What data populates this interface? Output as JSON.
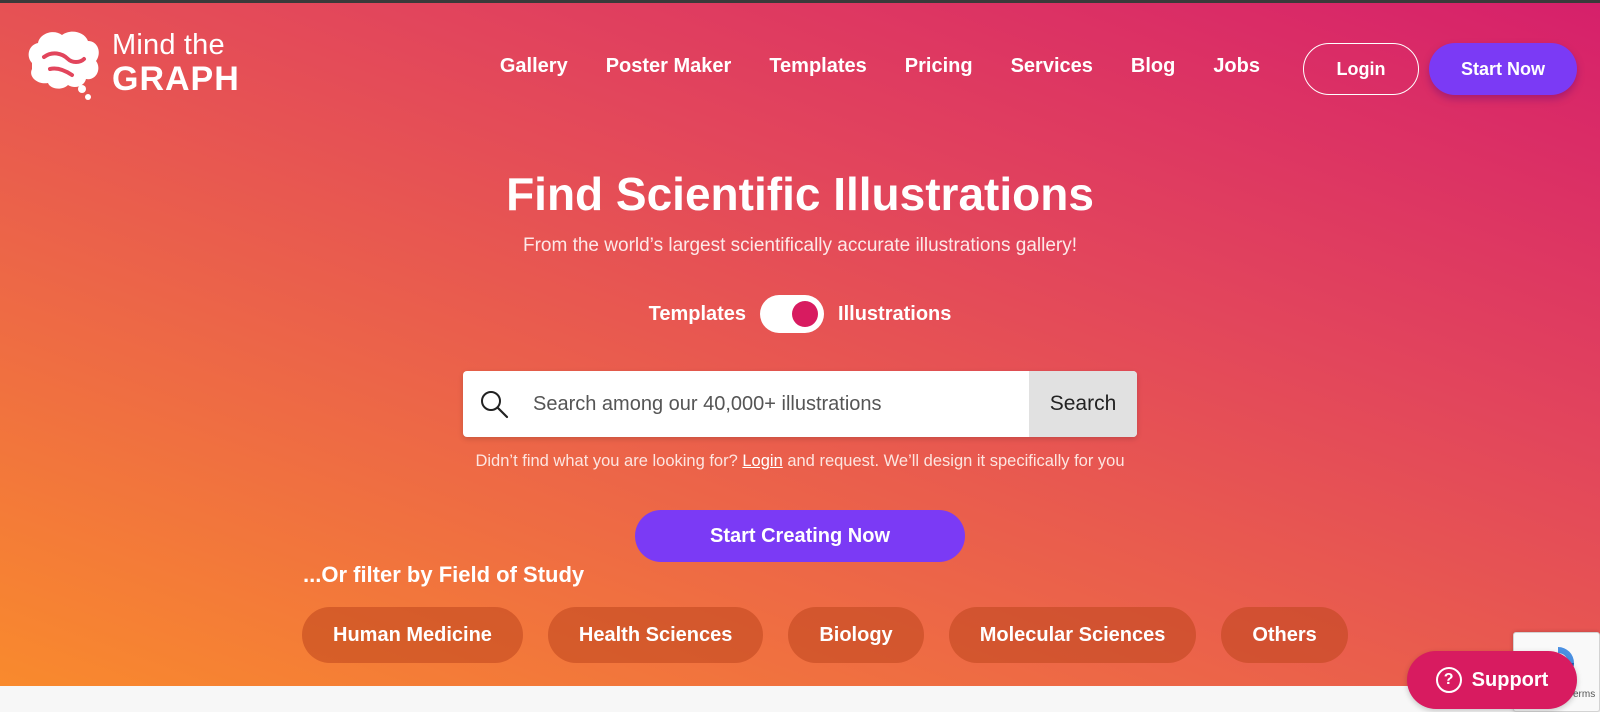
{
  "brand": {
    "line1": "Mind the",
    "line2": "GRAPH"
  },
  "nav": {
    "items": [
      "Gallery",
      "Poster Maker",
      "Templates",
      "Pricing",
      "Services",
      "Blog",
      "Jobs"
    ],
    "login": "Login",
    "start_now": "Start Now"
  },
  "hero": {
    "title": "Find Scientific Illustrations",
    "subtitle": "From the world’s largest scientifically accurate illustrations gallery!",
    "toggle_left": "Templates",
    "toggle_right": "Illustrations",
    "toggle_state": "Illustrations"
  },
  "search": {
    "placeholder": "Search among our 40,000+ illustrations",
    "button": "Search"
  },
  "help": {
    "before": "Didn’t find what you are looking for? ",
    "link": "Login",
    "after": " and request. We’ll design it specifically for you"
  },
  "cta": {
    "label": "Start Creating Now"
  },
  "filters": {
    "label": "...Or filter by Field of Study",
    "chips": [
      "Human Medicine",
      "Health Sciences",
      "Biology",
      "Molecular Sciences",
      "Others"
    ]
  },
  "recaptcha": {
    "terms": "Terms"
  },
  "support": {
    "label": "Support"
  },
  "colors": {
    "accent_purple": "#7b3af5",
    "brand_pink": "#d81b60",
    "gradient_top": "#d6206b",
    "gradient_bottom": "#f98a2d"
  }
}
